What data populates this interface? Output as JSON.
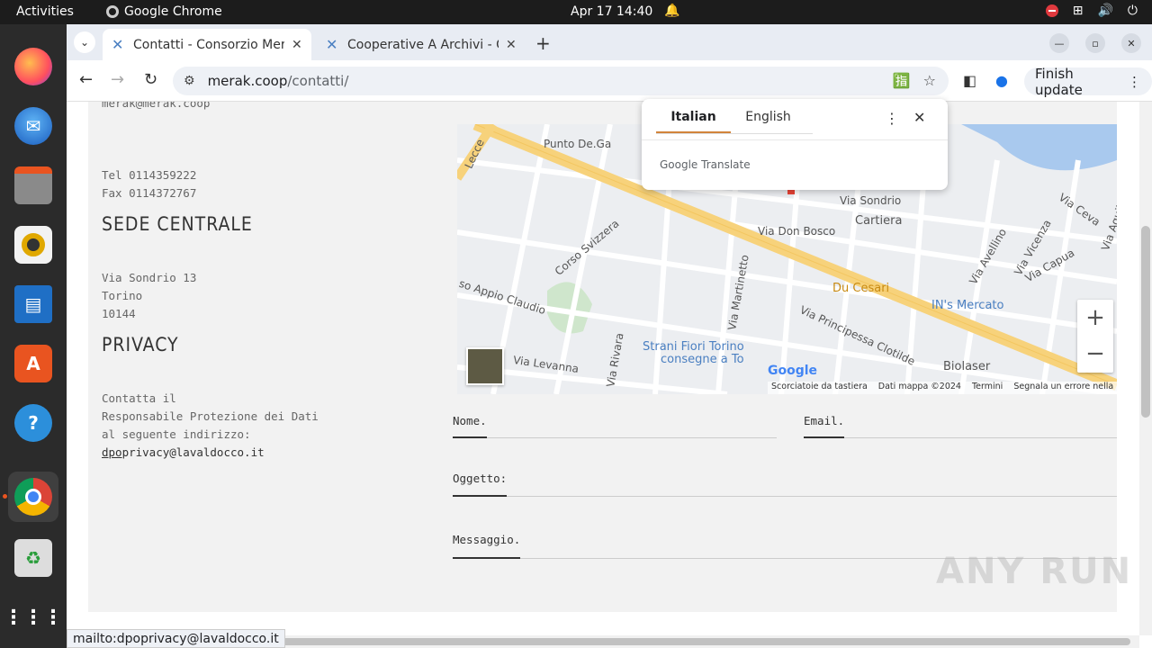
{
  "topbar": {
    "activities": "Activities",
    "app": "Google Chrome",
    "datetime": "Apr 17  14:40"
  },
  "dock": {
    "items": [
      "firefox",
      "thunderbird",
      "files",
      "rhythmbox",
      "libreoffice-writer",
      "app-center",
      "help",
      "chrome",
      "trash",
      "show-apps"
    ]
  },
  "browser": {
    "tabs": [
      {
        "title": "Contatti - Consorzio Mer",
        "active": true
      },
      {
        "title": "Cooperative A Archivi - C",
        "active": false
      }
    ],
    "url_host": "merak.coop",
    "url_path": "/contatti/",
    "finish_update": "Finish update"
  },
  "translate_popup": {
    "lang_source": "Italian",
    "lang_target": "English",
    "brand": "Google Translate"
  },
  "contact": {
    "cut_line": "merak@merak.coop",
    "tel": "Tel 0114359222",
    "fax": "Fax 0114372767",
    "sede_heading": "SEDE CENTRALE",
    "street": "Via Sondrio 13",
    "city": "Torino",
    "zip": "10144",
    "privacy_heading": "PRIVACY",
    "privacy_lines": [
      "Contatta il",
      "Responsabile Protezione dei Dati",
      "al seguente indirizzo:"
    ],
    "privacy_email_u": "dpo",
    "privacy_email_rest": "privacy@lavaldocco.it"
  },
  "map": {
    "labels": {
      "lecce": "Lecce",
      "punto": "Punto De.Ga",
      "svizzera": "Corso Svizzera",
      "appio": "so Appio Claudio",
      "levanna": "Via Levanna",
      "rivara": "Via Rivara",
      "martinetto": "Via Martinetto",
      "donbosco": "Via Don Bosco",
      "sondrio": "Via Sondrio",
      "cartiera": "Cartiera",
      "ducesari": "Du Cesari",
      "principessa": "Via Principessa Clotilde",
      "avellino": "Via Avellino",
      "vicenza": "Via Vicenza",
      "capua": "Via Capua",
      "ceva": "Via Ceva",
      "aquila": "Via Aquila",
      "mercato": "IN's Mercato",
      "bioloaser": "Biolaser",
      "fiori1": "Strani Fiori Torino",
      "fiori2": "consegne a To"
    },
    "google": "Google",
    "footer": [
      "Scorciatoie da tastiera",
      "Dati mappa ©2024",
      "Termini",
      "Segnala un errore nella mappa"
    ]
  },
  "form": {
    "nome": "Nome.",
    "email": "Email.",
    "oggetto": "Oggetto:",
    "messaggio": "Messaggio."
  },
  "status_url": "mailto:dpoprivacy@lavaldocco.it",
  "watermark": "ANY RUN"
}
